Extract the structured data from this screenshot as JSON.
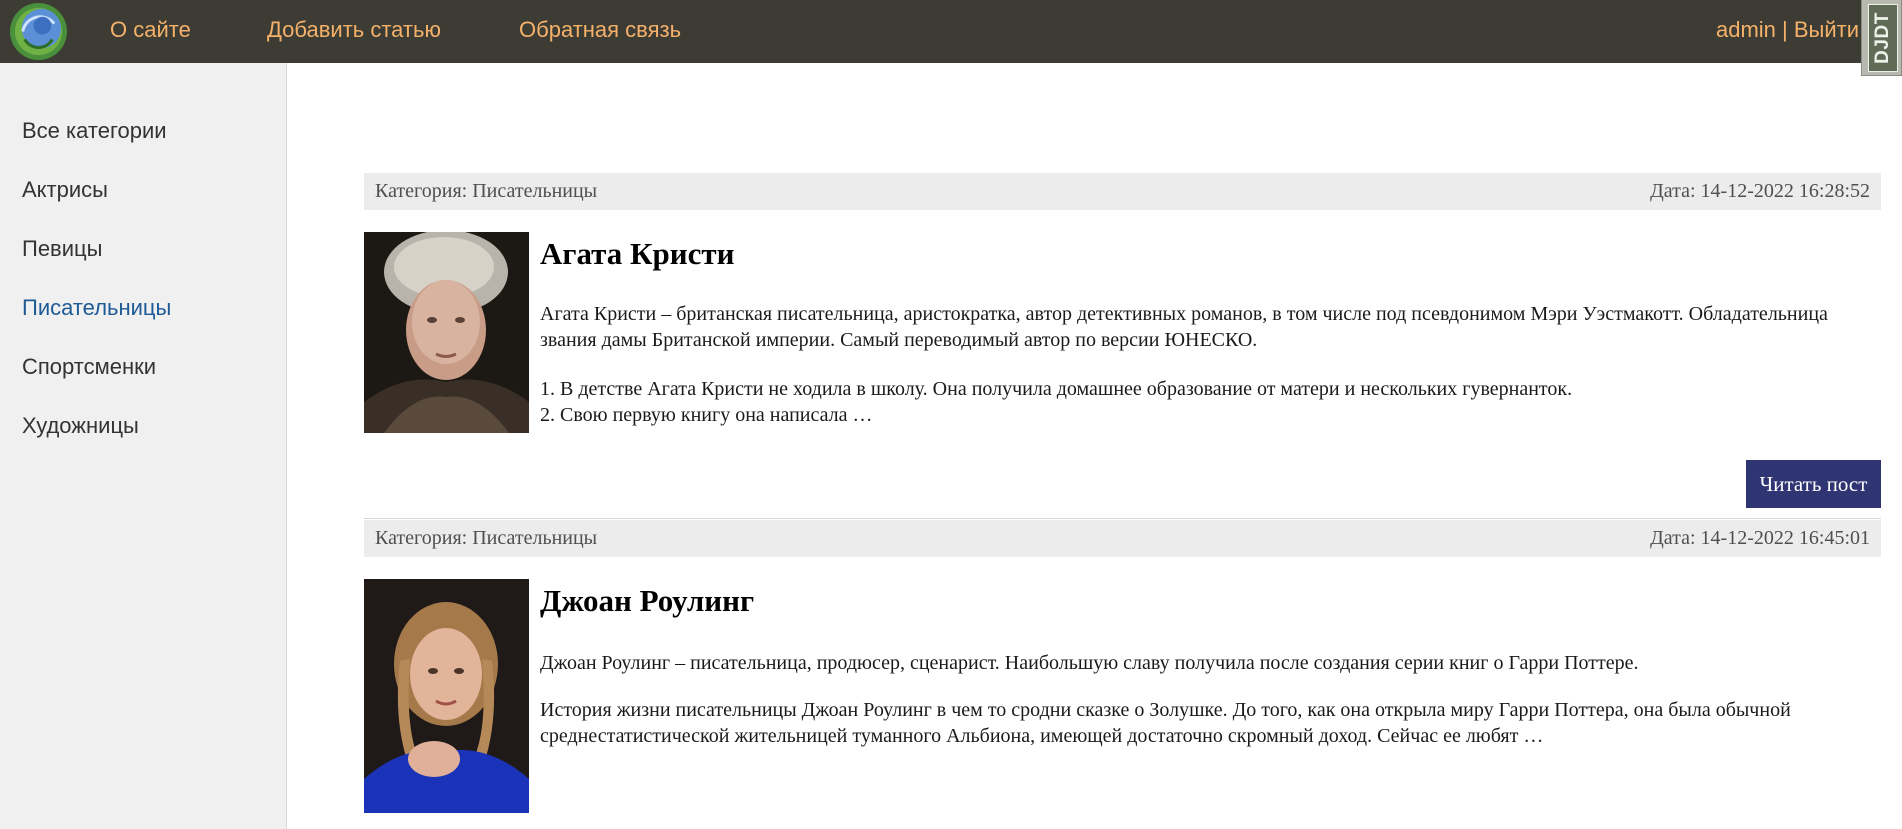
{
  "header": {
    "nav": {
      "about": "О сайте",
      "add_article": "Добавить статью",
      "feedback": "Обратная связь"
    },
    "user": {
      "name": "admin",
      "separator": " | ",
      "logout": "Выйти"
    },
    "debug_toolbar_label": "DJDT",
    "colors": {
      "background": "#3c3c35",
      "link": "#f5b16a"
    }
  },
  "sidebar": {
    "categories": [
      {
        "label": "Все категории",
        "selected": false
      },
      {
        "label": "Актрисы",
        "selected": false
      },
      {
        "label": "Певицы",
        "selected": false
      },
      {
        "label": "Писательницы",
        "selected": true
      },
      {
        "label": "Спортсменки",
        "selected": false
      },
      {
        "label": "Художницы",
        "selected": false
      }
    ],
    "selected_color": "#1e5a96"
  },
  "posts": [
    {
      "category": "Категория: Писательницы",
      "date": "Дата: 14-12-2022 16:28:52",
      "title": "Агата Кристи",
      "paragraph1": "Агата Кристи – британская писательница, аристократка, автор детективных романов, в том числе под псевдонимом Мэри Уэстмакотт. Обладательница звания дамы Британской империи. Самый переводимый автор по версии ЮНЕСКО.",
      "paragraph2_line1": "1. В детстве Агата Кристи не ходила в школу. Она получила домашнее образование от матери и нескольких гувернанток.",
      "paragraph2_line2": "2. Свою первую книгу она написала …",
      "read_button": "Читать пост"
    },
    {
      "category": "Категория: Писательницы",
      "date": "Дата: 14-12-2022 16:45:01",
      "title": "Джоан Роулинг",
      "paragraph1": "Джоан Роулинг – писательница, продюсер, сценарист. Наибольшую славу получила после создания серии книг о Гарри Поттере.",
      "paragraph2": "История жизни писательницы Джоан Роулинг в чем то сродни сказке о Золушке. До того, как она открыла миру Гарри Поттера, она была обычной среднестатистической жительницей туманного Альбиона, имеющей достаточно скромный доход. Сейчас ее любят …"
    }
  ],
  "button_color": "#2f3472"
}
